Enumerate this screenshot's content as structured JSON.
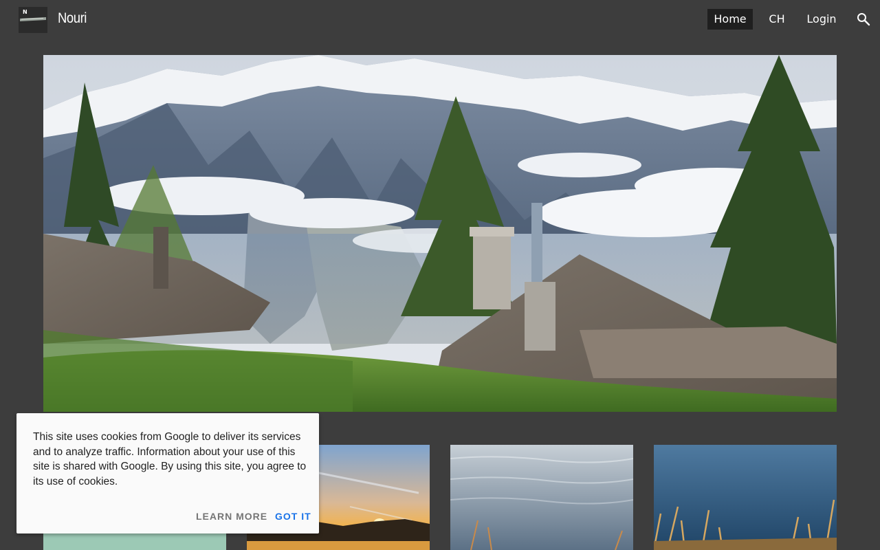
{
  "header": {
    "logo_letter": "N",
    "site_title": "Nouri",
    "nav": {
      "home": "Home",
      "ch": "CH",
      "login": "Login"
    },
    "active_nav": "Home",
    "search_icon": "search-icon"
  },
  "cookie_banner": {
    "message": "This site uses cookies from Google to deliver its services and to analyze traffic. Information about your use of this site is shared with Google. By using this site, you agree to its use of cookies.",
    "learn_more_label": "LEARN MORE",
    "got_it_label": "GOT IT"
  },
  "colors": {
    "background": "#3d3d3d",
    "active_nav_bg": "#1f1f1f",
    "got_it": "#1a73e8",
    "learn_more": "#757575",
    "cookie_bg": "#fafafa"
  }
}
